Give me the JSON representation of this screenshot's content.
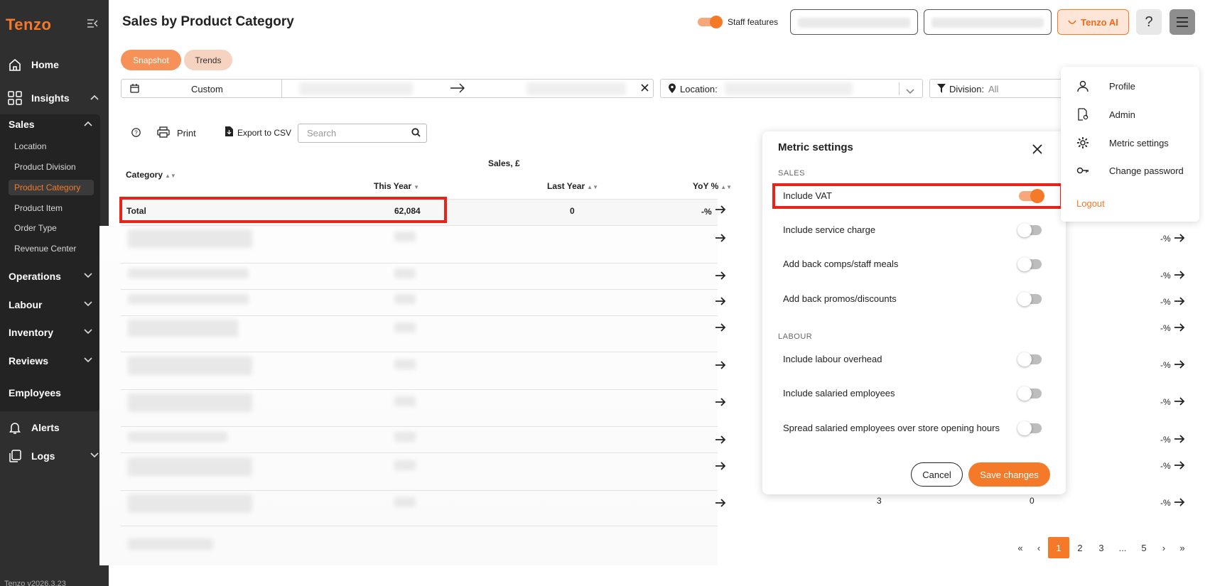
{
  "app": {
    "logo": "Tenzo",
    "version": "Tenzo v2026.3.23"
  },
  "sidebar": {
    "home": "Home",
    "insights": "Insights",
    "sales": "Sales",
    "sales_items": [
      "Location",
      "Product Division",
      "Product Category",
      "Product Item",
      "Order Type",
      "Revenue Center"
    ],
    "active_item": "Product Category",
    "operations": "Operations",
    "labour": "Labour",
    "inventory": "Inventory",
    "reviews": "Reviews",
    "employees": "Employees",
    "alerts": "Alerts",
    "logs": "Logs"
  },
  "header": {
    "title": "Sales by Product Category",
    "staff_features": "Staff features",
    "ai_button": "Tenzo AI",
    "help": "?"
  },
  "tabs": {
    "snapshot": "Snapshot",
    "trends": "Trends"
  },
  "filters": {
    "date_mode": "Custom",
    "location_label": "Location:",
    "division_label": "Division:",
    "division_value": "All"
  },
  "toolbar": {
    "print": "Print",
    "export": "Export to CSV",
    "search_placeholder": "Search"
  },
  "table": {
    "group_header": "Sales, £",
    "col_category": "Category",
    "col_this_year": "This Year",
    "col_last_year": "Last Year",
    "col_yoy": "YoY %",
    "total_label": "Total",
    "total_this_year": "62,084",
    "total_last_year": "0",
    "total_yoy": "-%",
    "right_pct": "-%",
    "last_row_a": "3",
    "last_row_b": "0"
  },
  "metric_settings": {
    "title": "Metric settings",
    "sales_section": "SALES",
    "labour_section": "LABOUR",
    "options": [
      {
        "label": "Include VAT",
        "on": true
      },
      {
        "label": "Include service charge",
        "on": false
      },
      {
        "label": "Add back comps/staff meals",
        "on": false
      },
      {
        "label": "Add back promos/discounts",
        "on": false
      },
      {
        "label": "Include labour overhead",
        "on": false
      },
      {
        "label": "Include salaried employees",
        "on": false
      },
      {
        "label": "Spread salaried employees over store opening hours",
        "on": false
      }
    ],
    "cancel": "Cancel",
    "save": "Save changes"
  },
  "user_menu": {
    "profile": "Profile",
    "admin": "Admin",
    "metric_settings": "Metric settings",
    "change_password": "Change password",
    "logout": "Logout"
  },
  "pagination": {
    "first": "«",
    "prev": "‹",
    "pages": [
      "1",
      "2",
      "3",
      "...",
      "5"
    ],
    "next": "›",
    "last": "»",
    "current": "1"
  },
  "colors": {
    "accent": "#f47a2a",
    "sidebar": "#2f2f2f",
    "highlight": "#e8231a"
  }
}
